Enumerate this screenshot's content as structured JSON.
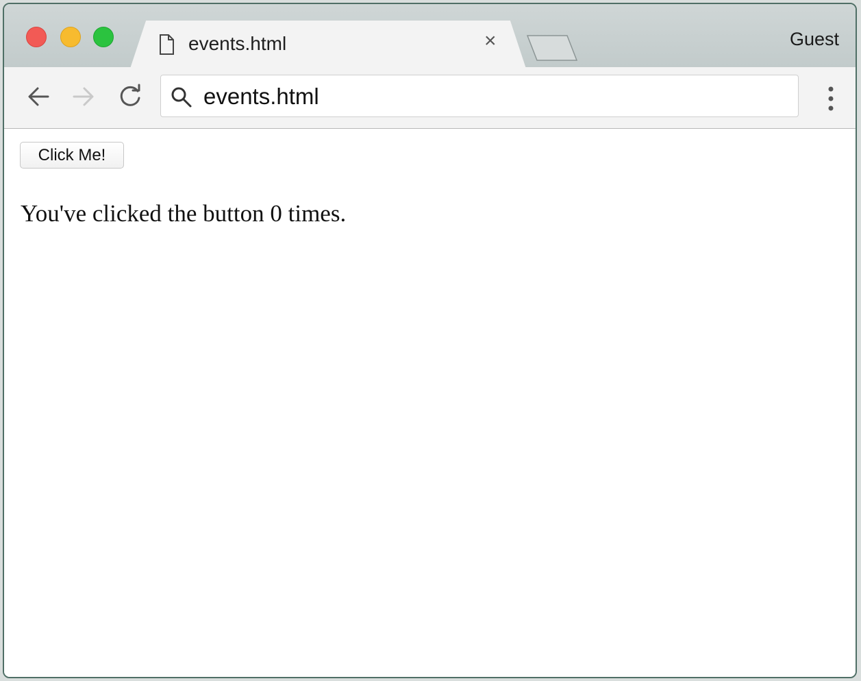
{
  "window": {
    "tab_title": "events.html",
    "profile_label": "Guest"
  },
  "toolbar": {
    "address_text": "events.html"
  },
  "page": {
    "button_label": "Click Me!",
    "message": "You've clicked the button 0 times."
  },
  "icons": [
    "close-window-icon",
    "minimize-window-icon",
    "zoom-window-icon",
    "document-icon",
    "close-tab-icon",
    "back-arrow-icon",
    "forward-arrow-icon",
    "reload-icon",
    "search-icon",
    "kebab-menu-icon"
  ],
  "colors": {
    "traffic_red": "#f25a55",
    "traffic_yellow": "#f7bb2f",
    "traffic_green": "#2bc33f",
    "window_border": "#4f6f66"
  }
}
